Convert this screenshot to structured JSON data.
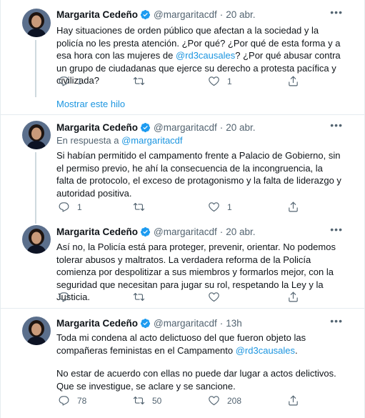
{
  "author": {
    "name": "Margarita Cedeño",
    "handle": "@margaritacdf"
  },
  "show_thread_label": "Mostrar este hilo",
  "tweets": [
    {
      "time": "20 abr.",
      "text_parts": [
        "Hay situaciones de orden público que afectan a la sociedad y la policía no les presta atención. ¿Por qué? ¿Por qué de esta forma y a esa hora con las mujeres de ",
        "@rd3causales",
        "? ¿Por qué abusar contra un grupo de ciudadanas que ejerce su derecho a protesta pacífica y civilizada?"
      ],
      "replies": "1",
      "retweets": "",
      "likes": "1"
    },
    {
      "time": "20 abr.",
      "reply_prefix": "En respuesta a",
      "reply_to": "@margaritacdf",
      "text": "Si habían  permitido el campamento frente a Palacio de Gobierno, sin el permiso previo, he ahí la consecuencia de la incongruencia, la falta de protocolo, el exceso de protagonismo y la falta de liderazgo y autoridad positiva.",
      "replies": "1",
      "retweets": "",
      "likes": "1"
    },
    {
      "time": "20 abr.",
      "text": "Así no, la Policía está para proteger, prevenir, orientar. No podemos tolerar abusos y maltratos. La verdadera reforma de la Policía comienza por despolitizar a sus miembros y formarlos mejor, con la seguridad que necesitan para jugar su rol, respetando la Ley y la Justicia.",
      "replies": "",
      "retweets": "",
      "likes": ""
    },
    {
      "time": "13h",
      "text_parts": [
        "Toda mi condena al acto delictuoso del que fueron objeto las compañeras feministas en el Campamento ",
        "@rd3causales",
        "."
      ],
      "text_2": "No estar de acuerdo con ellas no puede dar lugar a actos delictivos. Que se investigue, se aclare y se sancione.",
      "replies": "78",
      "retweets": "50",
      "likes": "208"
    }
  ],
  "colors": {
    "accent": "#1b95e0",
    "muted": "#536471",
    "text": "#0f1419",
    "divider": "#e6ecf0"
  },
  "icons": [
    "reply-icon",
    "retweet-icon",
    "like-icon",
    "share-icon",
    "verified-badge-icon",
    "more-icon"
  ]
}
